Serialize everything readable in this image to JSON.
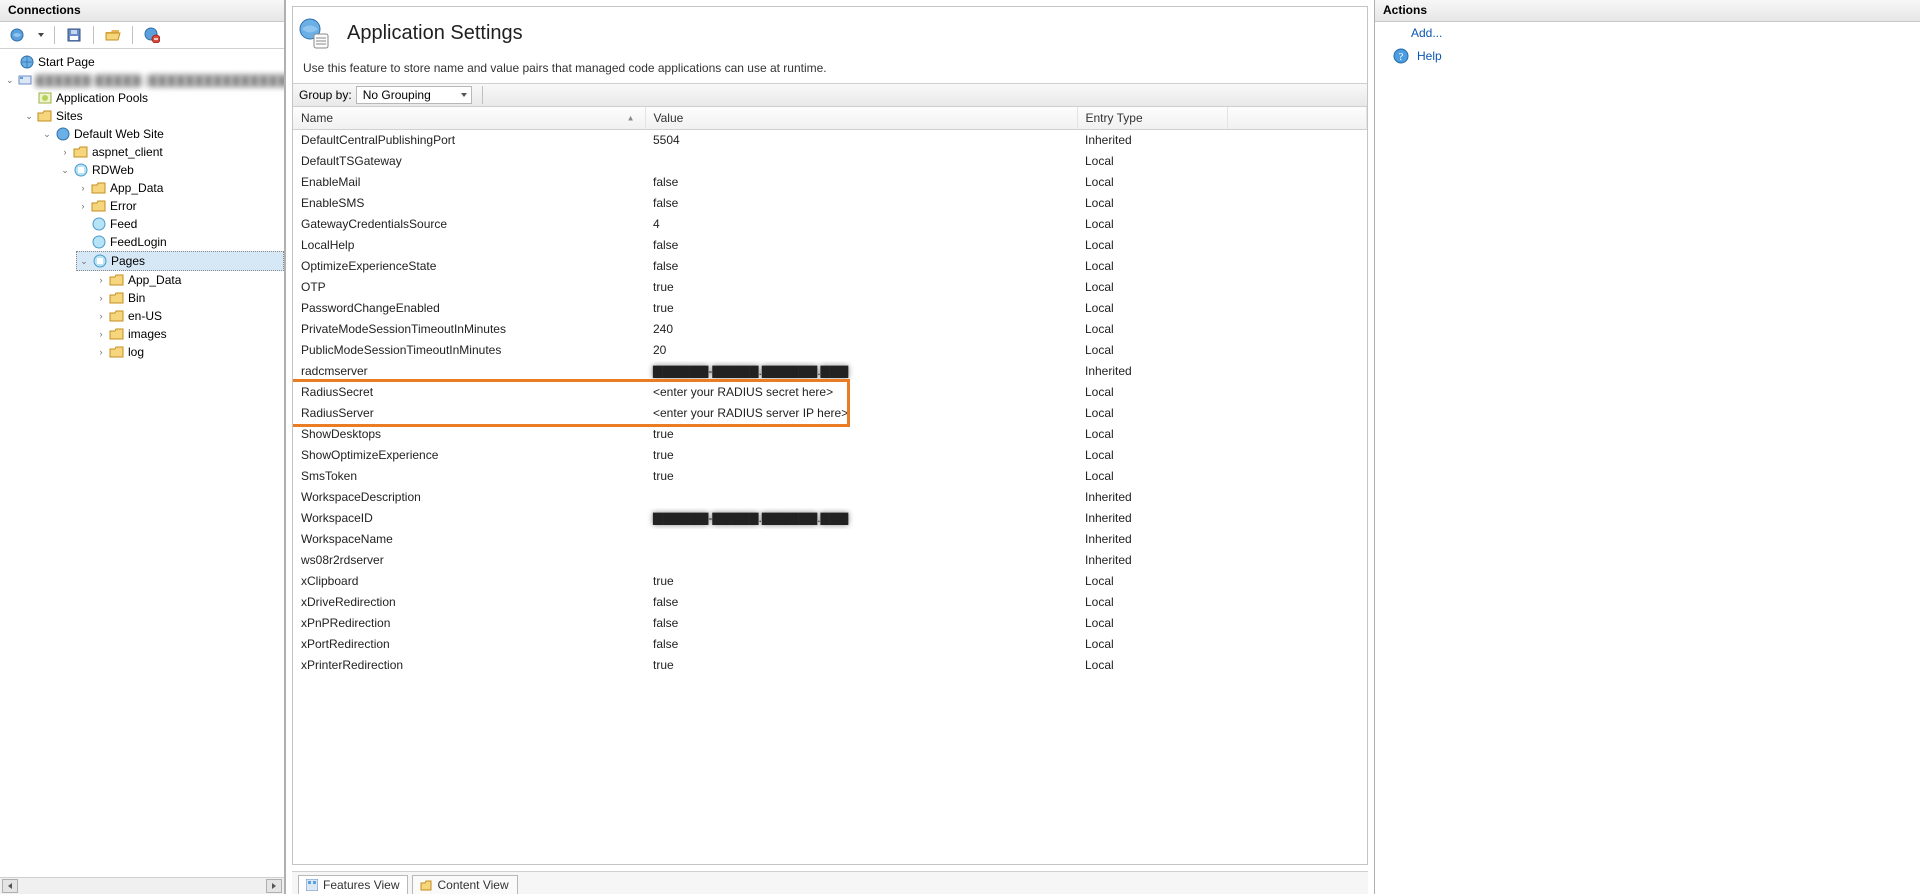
{
  "connections": {
    "title": "Connections",
    "toolbar_icons": [
      "globe-refresh-icon",
      "save-icon",
      "folder-open-icon",
      "globe-stop-icon"
    ],
    "tree": {
      "start_page": "Start Page",
      "server_name": "▇▇▇▇▇▇-▇▇▇▇▇ (▇▇▇▇▇▇▇▇▇▇▇▇▇▇▇▇▇)",
      "app_pools": "Application Pools",
      "sites": "Sites",
      "default_site": "Default Web Site",
      "aspnet_client": "aspnet_client",
      "rdweb": "RDWeb",
      "app_data": "App_Data",
      "error": "Error",
      "feed": "Feed",
      "feedlogin": "FeedLogin",
      "pages": "Pages",
      "pages_children": {
        "app_data": "App_Data",
        "bin": "Bin",
        "en_us": "en-US",
        "images": "images",
        "log": "log"
      }
    }
  },
  "main": {
    "title": "Application Settings",
    "description": "Use this feature to store name and value pairs that managed code applications can use at runtime.",
    "group_by_label": "Group by:",
    "group_by_value": "No Grouping",
    "columns": {
      "name": "Name",
      "value": "Value",
      "entry_type": "Entry Type"
    },
    "rows": [
      {
        "name": "DefaultCentralPublishingPort",
        "value": "5504",
        "type": "Inherited",
        "hl": false,
        "blur": false
      },
      {
        "name": "DefaultTSGateway",
        "value": "",
        "type": "Local",
        "hl": false,
        "blur": false
      },
      {
        "name": "EnableMail",
        "value": "false",
        "type": "Local",
        "hl": false,
        "blur": false
      },
      {
        "name": "EnableSMS",
        "value": "false",
        "type": "Local",
        "hl": false,
        "blur": false
      },
      {
        "name": "GatewayCredentialsSource",
        "value": "4",
        "type": "Local",
        "hl": false,
        "blur": false
      },
      {
        "name": "LocalHelp",
        "value": "false",
        "type": "Local",
        "hl": false,
        "blur": false
      },
      {
        "name": "OptimizeExperienceState",
        "value": "false",
        "type": "Local",
        "hl": false,
        "blur": false
      },
      {
        "name": "OTP",
        "value": "true",
        "type": "Local",
        "hl": false,
        "blur": false
      },
      {
        "name": "PasswordChangeEnabled",
        "value": "true",
        "type": "Local",
        "hl": false,
        "blur": false
      },
      {
        "name": "PrivateModeSessionTimeoutInMinutes",
        "value": "240",
        "type": "Local",
        "hl": false,
        "blur": false
      },
      {
        "name": "PublicModeSessionTimeoutInMinutes",
        "value": "20",
        "type": "Local",
        "hl": false,
        "blur": false
      },
      {
        "name": "radcmserver",
        "value": "▇▇▇▇▇▇-▇▇▇▇▇.▇▇▇▇▇▇.▇▇▇",
        "type": "Inherited",
        "hl": false,
        "blur": true
      },
      {
        "name": "RadiusSecret",
        "value": "<enter your RADIUS secret here>",
        "type": "Local",
        "hl": true,
        "blur": false
      },
      {
        "name": "RadiusServer",
        "value": "<enter your RADIUS server IP here>",
        "type": "Local",
        "hl": true,
        "blur": false
      },
      {
        "name": "ShowDesktops",
        "value": "true",
        "type": "Local",
        "hl": false,
        "blur": false
      },
      {
        "name": "ShowOptimizeExperience",
        "value": "true",
        "type": "Local",
        "hl": false,
        "blur": false
      },
      {
        "name": "SmsToken",
        "value": "true",
        "type": "Local",
        "hl": false,
        "blur": false
      },
      {
        "name": "WorkspaceDescription",
        "value": "",
        "type": "Inherited",
        "hl": false,
        "blur": false
      },
      {
        "name": "WorkspaceID",
        "value": "▇▇▇▇▇▇-▇▇▇▇▇.▇▇▇▇▇▇.▇▇▇",
        "type": "Inherited",
        "hl": false,
        "blur": true
      },
      {
        "name": "WorkspaceName",
        "value": "",
        "type": "Inherited",
        "hl": false,
        "blur": false
      },
      {
        "name": "ws08r2rdserver",
        "value": "",
        "type": "Inherited",
        "hl": false,
        "blur": false
      },
      {
        "name": "xClipboard",
        "value": "true",
        "type": "Local",
        "hl": false,
        "blur": false
      },
      {
        "name": "xDriveRedirection",
        "value": "false",
        "type": "Local",
        "hl": false,
        "blur": false
      },
      {
        "name": "xPnPRedirection",
        "value": "false",
        "type": "Local",
        "hl": false,
        "blur": false
      },
      {
        "name": "xPortRedirection",
        "value": "false",
        "type": "Local",
        "hl": false,
        "blur": false
      },
      {
        "name": "xPrinterRedirection",
        "value": "true",
        "type": "Local",
        "hl": false,
        "blur": false
      }
    ],
    "bottom_tabs": {
      "features": "Features View",
      "content": "Content View"
    }
  },
  "actions": {
    "title": "Actions",
    "add": "Add...",
    "help": "Help"
  }
}
